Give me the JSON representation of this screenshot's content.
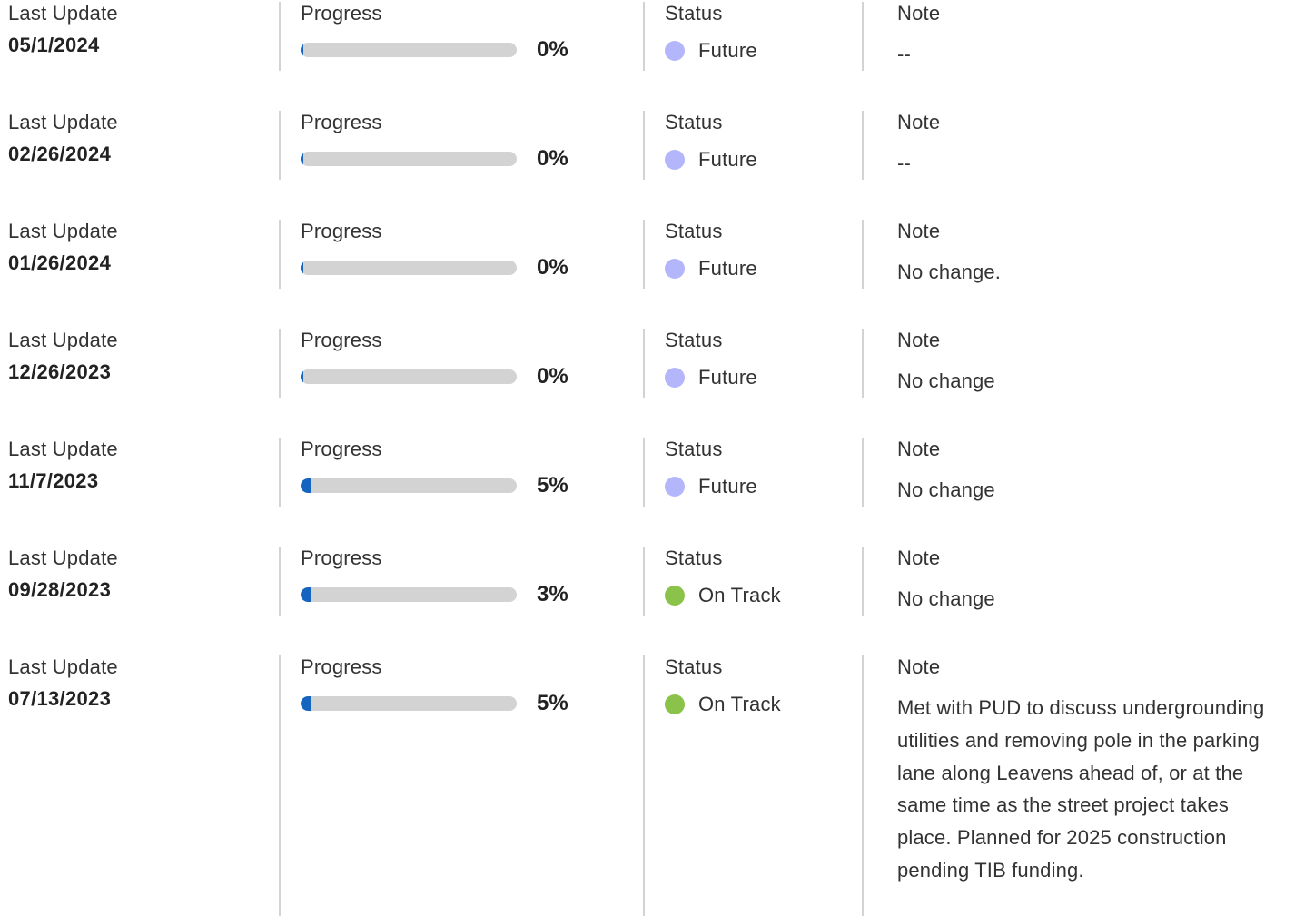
{
  "labels": {
    "last_update": "Last Update",
    "progress": "Progress",
    "status": "Status",
    "note": "Note"
  },
  "colors": {
    "future": "#b3b6fb",
    "on_track": "#8bc34a",
    "progress_fill": "#1565c0",
    "progress_track": "#d3d3d3",
    "divider": "#d3d3d3"
  },
  "entries": [
    {
      "date": "05/1/2024",
      "progress": 0,
      "progress_label": "0%",
      "status": "Future",
      "status_key": "future",
      "note": "--"
    },
    {
      "date": "02/26/2024",
      "progress": 0,
      "progress_label": "0%",
      "status": "Future",
      "status_key": "future",
      "note": "--"
    },
    {
      "date": "01/26/2024",
      "progress": 0,
      "progress_label": "0%",
      "status": "Future",
      "status_key": "future",
      "note": "No change."
    },
    {
      "date": "12/26/2023",
      "progress": 0,
      "progress_label": "0%",
      "status": "Future",
      "status_key": "future",
      "note": "No change"
    },
    {
      "date": "11/7/2023",
      "progress": 5,
      "progress_label": "5%",
      "status": "Future",
      "status_key": "future",
      "note": "No change"
    },
    {
      "date": "09/28/2023",
      "progress": 3,
      "progress_label": "3%",
      "status": "On Track",
      "status_key": "on_track",
      "note": "No change"
    },
    {
      "date": "07/13/2023",
      "progress": 5,
      "progress_label": "5%",
      "status": "On Track",
      "status_key": "on_track",
      "note": "Met with PUD to discuss undergrounding utilities and removing pole in the parking lane along Leavens ahead of, or at the same time as the street project takes place. Planned for 2025 construction pending TIB funding."
    }
  ]
}
